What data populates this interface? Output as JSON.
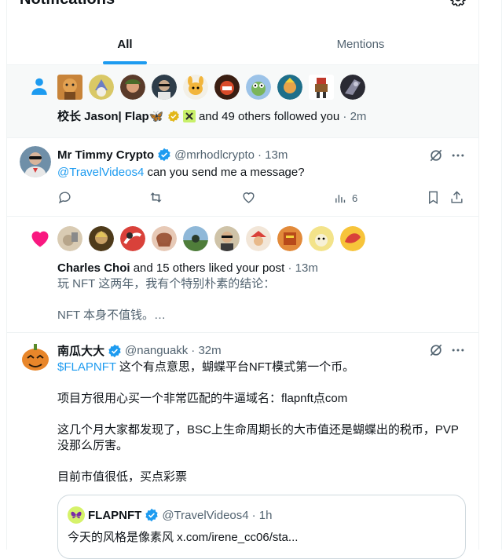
{
  "header": {
    "title": "Notifications",
    "settings_icon": "gear-icon"
  },
  "tabs": [
    {
      "label": "All",
      "active": true
    },
    {
      "label": "Mentions",
      "active": false
    }
  ],
  "follow_notification": {
    "icon": "person-icon",
    "names": "校长 Jason| Flap",
    "emoji": "🦋",
    "rest": " and 49 others followed you",
    "time": " · 2m",
    "avatar_count": 11
  },
  "tweet1": {
    "name": "Mr Timmy Crypto",
    "handle": "@mrhodlcrypto",
    "time": "· 13m",
    "mention": "@TravelVideos4",
    "text": " can you send me a message?",
    "views": "6"
  },
  "like_notification": {
    "icon": "heart-icon",
    "name": "Charles Choi",
    "rest": " and 15 others liked your post",
    "time": " · 13m",
    "line1": "玩 NFT 这两年，我有个特别朴素的结论：",
    "line2": "NFT 本身不值钱。…"
  },
  "tweet2": {
    "name": "南瓜大大",
    "handle": "@nanguakk",
    "time": "· 32m",
    "cashtag": "$FLAPNFT",
    "text1": " 这个有点意思，蝴蝶平台NFT模式第一个币。",
    "text2": "项目方很用心买一个非常匹配的牛逼域名：flapnft点com",
    "text3a": "这几个月大家都发现了，BSC上生命周期长的大市值还是蝴蝶出的税币，PVP",
    "text3b": "没那么厉害。",
    "text4": "目前市值很低，买点彩票",
    "quote": {
      "name": "FLAPNFT",
      "handle": "@TravelVideos4",
      "time": "· 1h",
      "text": "今天的风格是像素风  x.com/irene_cc06/sta..."
    }
  },
  "colors": {
    "accent": "#1d9bf0",
    "like": "#f91880",
    "muted": "#536471",
    "verified": "#1d9bf0",
    "gold": "#e2b719"
  }
}
